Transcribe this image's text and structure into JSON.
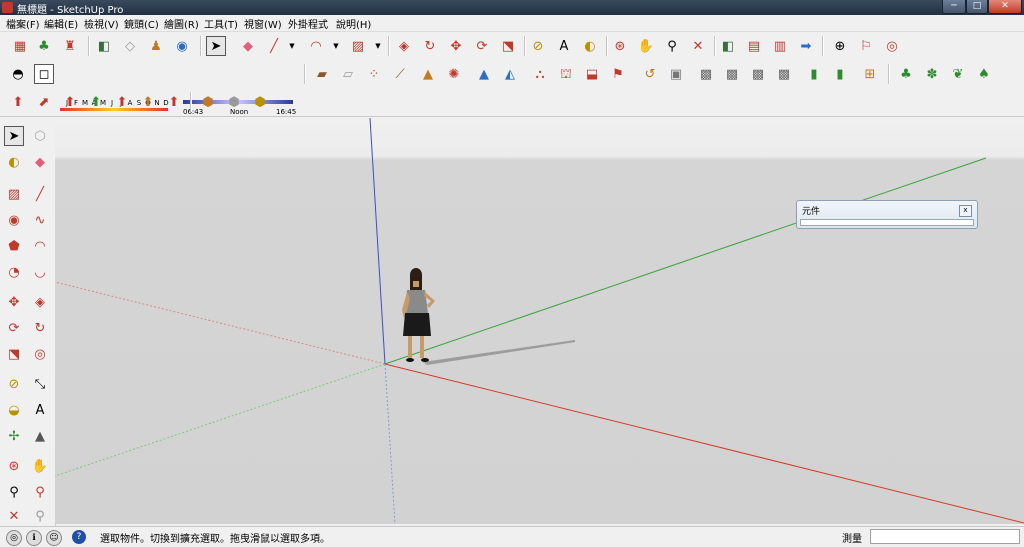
{
  "window": {
    "title": "無標題 - SketchUp Pro",
    "min": "─",
    "max": "□",
    "close": "✕"
  },
  "menu": [
    "檔案(F)",
    "編輯(E)",
    "檢視(V)",
    "鏡頭(C)",
    "繪圖(R)",
    "工具(T)",
    "視窗(W)",
    "外掛程式",
    "說明(H)"
  ],
  "shadow": {
    "months": [
      "J",
      "F",
      "M",
      "A",
      "M",
      "J",
      "J",
      "A",
      "S",
      "O",
      "N",
      "D"
    ],
    "time_start": "06:43",
    "time_noon": "Noon",
    "time_end": "16:45"
  },
  "axes_colors": {
    "red": "#d33a2b",
    "green": "#3aa33a",
    "blue": "#3b4fc9"
  },
  "components_panel": {
    "title": "元件",
    "close": "x"
  },
  "status": {
    "text": "選取物件。切換到擴充選取。拖曳滑鼠以選取多項。",
    "measure_label": "測量",
    "measure_value": ""
  }
}
